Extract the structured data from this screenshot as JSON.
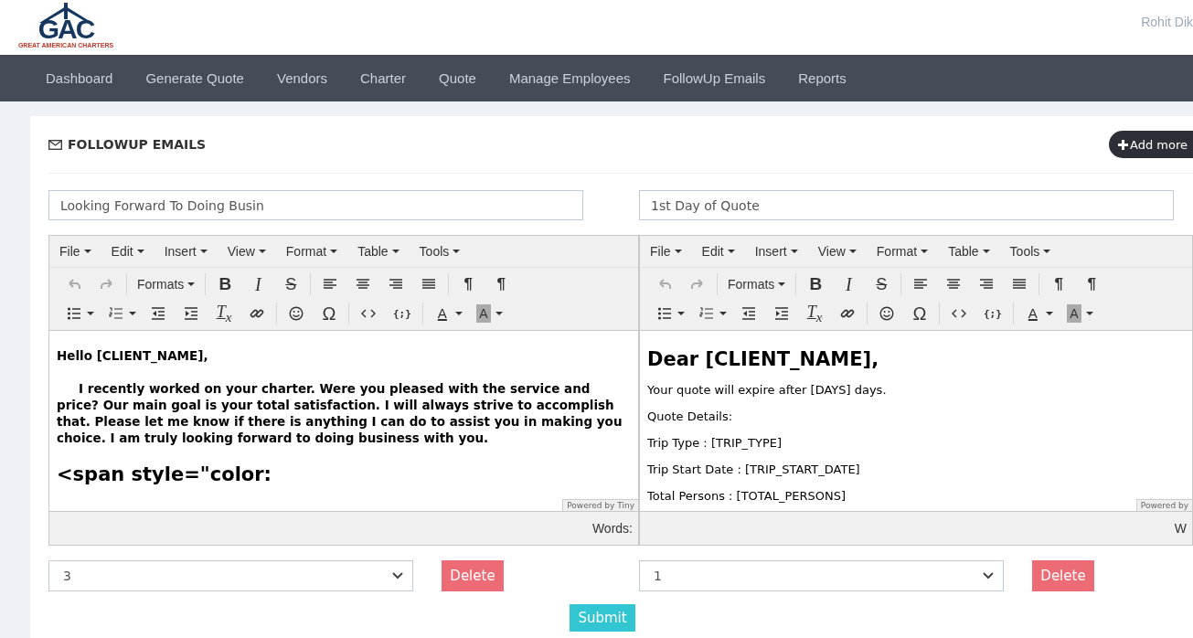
{
  "header": {
    "logo_mark": "GAC",
    "logo_tagline": "GREAT AMERICAN CHARTERS",
    "user_name": "Rohit Dik"
  },
  "nav": [
    "Dashboard",
    "Generate Quote",
    "Vendors",
    "Charter",
    "Quote",
    "Manage Employees",
    "FollowUp Emails",
    "Reports"
  ],
  "page": {
    "title": "FOLLOWUP EMAILS",
    "add_button": "Add more"
  },
  "emails": [
    {
      "subject": "Looking Forward To Doing Busin",
      "menus": [
        "File",
        "Edit",
        "Insert",
        "View",
        "Format",
        "Table",
        "Tools"
      ],
      "formats": "Formats",
      "history": {
        "undo_disabled": true,
        "redo_disabled": true
      },
      "glyphs": [
        "B",
        "I",
        "S",
        "¶",
        "¶",
        "T$_{x}$",
        "Ω",
        "{;}",
        "A",
        "A"
      ],
      "content": [
        {
          "kind": "strong",
          "text": "Hello [CLIENT_NAME],"
        },
        {
          "kind": "strong-indent",
          "text": "I recently worked on your charter. Were you pleased with the service and price? Our main goal is your total satisfaction. I will always strive to accomplish that. Please let me know if there is anything I can do to assist you in making you choice.  I am truly looking forward to doing business with you."
        },
        {
          "kind": "heading",
          "text": "<span style=\"color:"
        }
      ],
      "branding": "Powered by Tiny",
      "status": "Words:",
      "day": "3",
      "delete": "Delete"
    },
    {
      "subject": "1st Day of Quote",
      "menus": [
        "File",
        "Edit",
        "Insert",
        "View",
        "Format",
        "Table",
        "Tools"
      ],
      "formats": "Formats",
      "history": {
        "undo_disabled": true,
        "redo_disabled": true
      },
      "glyphs": [
        "B",
        "I",
        "S",
        "¶",
        "¶",
        "T$_{x}$",
        "Ω",
        "{;}",
        "A",
        "A"
      ],
      "content": [
        {
          "kind": "heading",
          "text": "Dear [CLIENT_NAME],"
        },
        {
          "kind": "text",
          "text": "Your quote will expire after [DAYS] days."
        },
        {
          "kind": "text",
          "text": "Quote Details:"
        },
        {
          "kind": "text",
          "text": "Trip Type : [TRIP_TYPE]"
        },
        {
          "kind": "text",
          "text": "Trip Start Date : [TRIP_START_DATE]"
        },
        {
          "kind": "text",
          "text": "Total Persons : [TOTAL_PERSONS]"
        }
      ],
      "branding": "Powered by",
      "status": "W",
      "day": "1",
      "delete": "Delete"
    }
  ],
  "submit": "Submit"
}
